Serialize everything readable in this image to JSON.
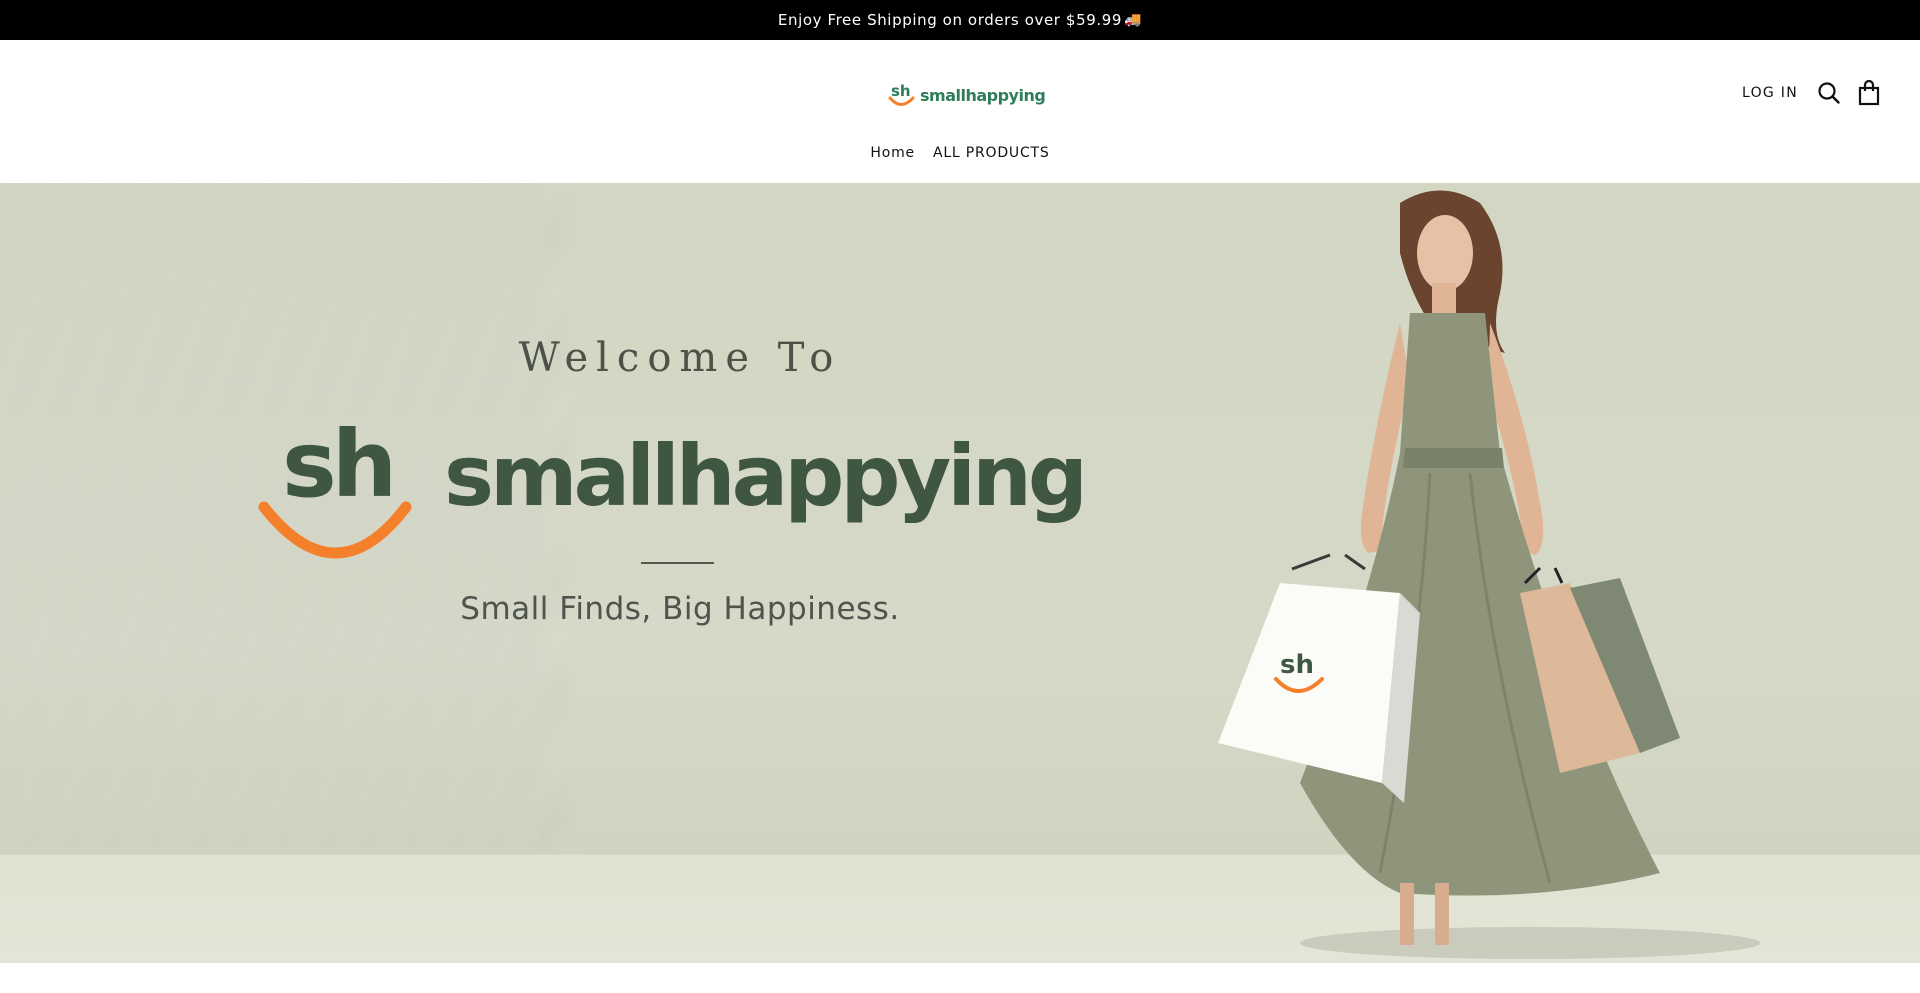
{
  "announcement": {
    "text": "Enjoy Free Shipping on orders over $59.99",
    "emoji": "🚚"
  },
  "header": {
    "logo": {
      "mark_text": "sh",
      "brand": "smallhappying"
    },
    "login_label": "LOG IN",
    "icons": [
      "search-icon",
      "shopping-bag-icon"
    ]
  },
  "nav": {
    "items": [
      {
        "label": "Home"
      },
      {
        "label": "ALL PRODUCTS"
      }
    ]
  },
  "hero": {
    "welcome": "Welcome To",
    "mark_text": "sh",
    "brand": "smallhappying",
    "tagline": "Small Finds, Big Happiness.",
    "bag_mark_text": "sh"
  },
  "colors": {
    "brand_green": "#2e7d5b",
    "hero_green": "#3f5640",
    "smile_orange": "#f5802b",
    "announce_bg": "#000000",
    "hero_bg": "#d2d6c3"
  }
}
